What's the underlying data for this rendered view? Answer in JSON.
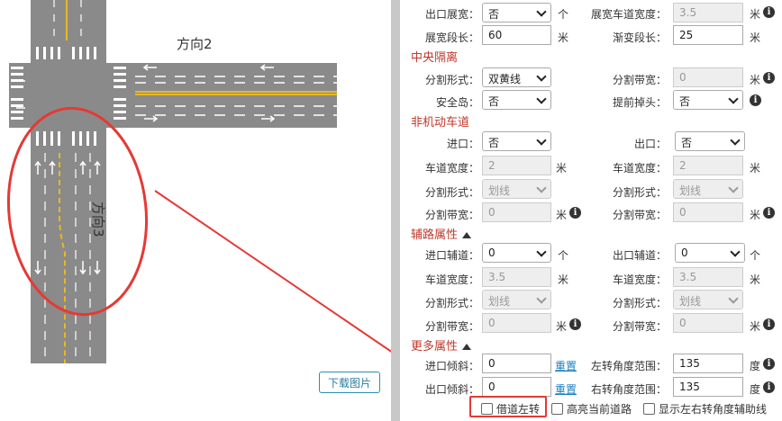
{
  "map": {
    "direction2": "方向2",
    "direction3": "方向3",
    "download": "下载图片"
  },
  "rows": {
    "exit_widen": {
      "label": "出口展宽：",
      "value": "否",
      "unit": "个"
    },
    "widen_lane_width": {
      "label": "展宽车道宽度：",
      "value": "3.5",
      "unit": "米"
    },
    "widen_len": {
      "label": "展宽段长：",
      "value": "60",
      "unit": "米"
    },
    "taper_len": {
      "label": "渐变段长：",
      "value": "25",
      "unit": "米"
    },
    "sec_median": "中央隔离",
    "median_form": {
      "label": "分割形式：",
      "value": "双黄线"
    },
    "median_width": {
      "label": "分割带宽：",
      "value": "0",
      "unit": "米"
    },
    "island": {
      "label": "安全岛：",
      "value": "否"
    },
    "early_uturn": {
      "label": "提前掉头：",
      "value": "否"
    },
    "sec_nonmotor": "非机动车道",
    "nm_entry": {
      "label": "进口：",
      "value": "否"
    },
    "nm_exit": {
      "label": "出口：",
      "value": "否"
    },
    "nm_width_l": {
      "label": "车道宽度：",
      "value": "2",
      "unit": "米"
    },
    "nm_width_r": {
      "label": "车道宽度：",
      "value": "2",
      "unit": "米"
    },
    "nm_form_l": {
      "label": "分割形式：",
      "value": "划线"
    },
    "nm_form_r": {
      "label": "分割形式：",
      "value": "划线"
    },
    "nm_band_l": {
      "label": "分割带宽：",
      "value": "0",
      "unit": "米"
    },
    "nm_band_r": {
      "label": "分割带宽：",
      "value": "0",
      "unit": "米"
    },
    "sec_aux": "辅路属性",
    "aux_entry": {
      "label": "进口辅道：",
      "value": "0",
      "unit": "个"
    },
    "aux_exit": {
      "label": "出口辅道：",
      "value": "0",
      "unit": "个"
    },
    "aux_width_l": {
      "label": "车道宽度：",
      "value": "3.5",
      "unit": "米"
    },
    "aux_width_r": {
      "label": "车道宽度：",
      "value": "3.5",
      "unit": "米"
    },
    "aux_form_l": {
      "label": "分割形式：",
      "value": "划线"
    },
    "aux_form_r": {
      "label": "分割形式：",
      "value": "划线"
    },
    "aux_band_l": {
      "label": "分割带宽：",
      "value": "0",
      "unit": "米"
    },
    "aux_band_r": {
      "label": "分割带宽：",
      "value": "0",
      "unit": "米"
    },
    "sec_more": "更多属性",
    "entry_skew": {
      "label": "进口倾斜：",
      "value": "0",
      "reset": "重置"
    },
    "left_angle": {
      "label": "左转角度范围：",
      "value": "135",
      "unit": "度"
    },
    "exit_skew": {
      "label": "出口倾斜：",
      "value": "0",
      "reset": "重置"
    },
    "right_angle": {
      "label": "右转角度范围：",
      "value": "135",
      "unit": "度"
    }
  },
  "checkboxes": {
    "borrow_left": "借道左转",
    "highlight_road": "高亮当前道路",
    "show_aux_lines": "显示左右转角度辅助线"
  },
  "colors": {
    "section": "#c0392b",
    "road": "#8a8a8a",
    "yellow": "#e8b820",
    "highlight": "#e53935",
    "link": "#1a7fc1"
  }
}
